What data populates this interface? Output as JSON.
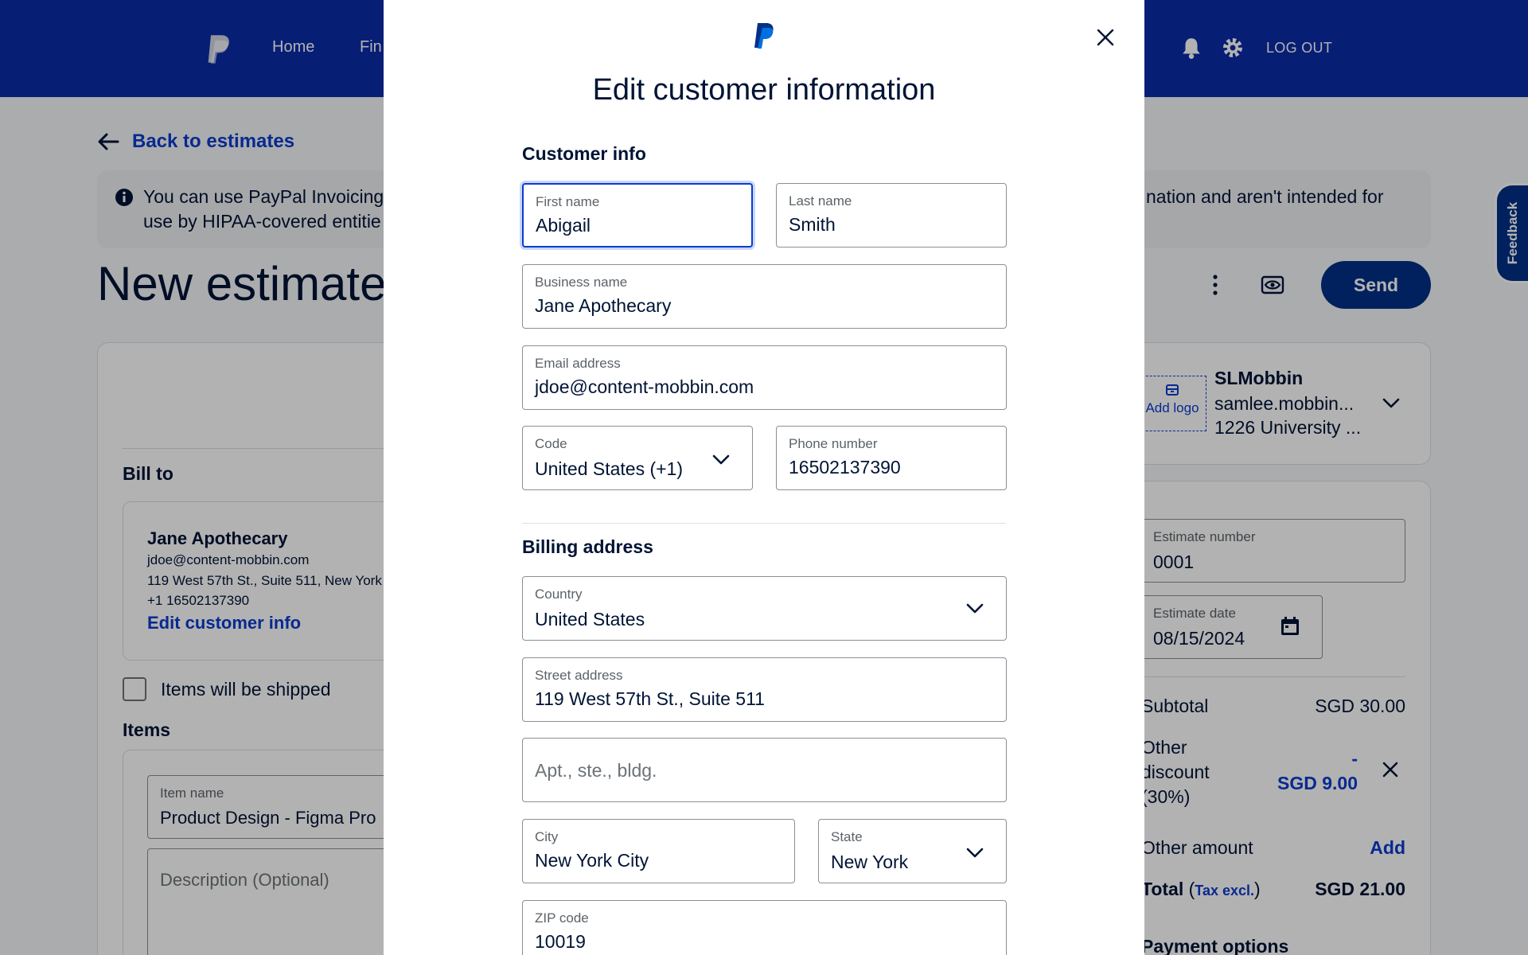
{
  "topbar": {
    "nav_home": "Home",
    "nav_finance_partial": "Fin",
    "logout": "LOG OUT"
  },
  "back_link": "Back to estimates",
  "banner": {
    "text_left": "You can use PayPal Invoicing to ... use by HIPAA-covered entitie",
    "text_left_line1": "You can use PayPal Invoicing",
    "text_left_line2": "use by HIPAA-covered entitie",
    "text_right": "nation and aren't intended for"
  },
  "page_title": "New estimate",
  "send_button": "Send",
  "bill_to": {
    "heading": "Bill to",
    "name": "Jane Apothecary",
    "email": "jdoe@content-mobbin.com",
    "address": "119 West 57th St., Suite 511, New York",
    "phone": "+1 16502137390",
    "edit_link": "Edit customer info"
  },
  "items_shipped_label": "Items will be shipped",
  "items": {
    "heading": "Items",
    "item_name_label": "Item name",
    "item_name_value": "Product Design - Figma Pro",
    "description_placeholder": "Description (Optional)"
  },
  "business": {
    "add_logo": "Add logo",
    "name": "SLMobbin",
    "email": "samlee.mobbin...",
    "address": "1226 University ..."
  },
  "estimate": {
    "number_label": "Estimate number",
    "number_value": "0001",
    "date_label": "Estimate date",
    "date_value": "08/15/2024"
  },
  "summary": {
    "subtotal_label": "Subtotal",
    "subtotal_value": "SGD 30.00",
    "discount_label_1": "Other",
    "discount_label_2": "discount",
    "discount_label_3": "(30%)",
    "discount_value_1": "-",
    "discount_value_2": "SGD 9.00",
    "other_amount_label": "Other amount",
    "other_amount_add": "Add",
    "total_label": "Total",
    "tax_note": "Tax excl.",
    "total_value": "SGD 21.00",
    "payment_options": "Payment options"
  },
  "feedback_tab": "Feedback",
  "modal": {
    "title": "Edit customer information",
    "customer_info_heading": "Customer info",
    "first_name_label": "First name",
    "first_name_value": "Abigail",
    "last_name_label": "Last name",
    "last_name_value": "Smith",
    "business_name_label": "Business name",
    "business_name_value": "Jane Apothecary",
    "email_label": "Email address",
    "email_value": "jdoe@content-mobbin.com",
    "code_label": "Code",
    "code_value": "United States (+1)",
    "phone_label": "Phone number",
    "phone_value": "16502137390",
    "billing_heading": "Billing address",
    "country_label": "Country",
    "country_value": "United States",
    "street_label": "Street address",
    "street_value": "119 West 57th St., Suite 511",
    "apt_placeholder": "Apt., ste., bldg.",
    "city_label": "City",
    "city_value": "New York City",
    "state_label": "State",
    "state_value": "New York",
    "zip_label": "ZIP code",
    "zip_value": "10019"
  },
  "colors": {
    "brand_navy": "#003087",
    "header_blue": "#0b2ca8",
    "link_blue": "#0b3bcf",
    "text_dark": "#001435"
  },
  "icons": [
    "paypal-logo-icon",
    "bell-icon",
    "gear-icon",
    "arrow-left-icon",
    "info-icon",
    "kebab-icon",
    "eye-icon",
    "store-icon",
    "chevron-down-icon",
    "calendar-icon",
    "close-icon"
  ]
}
